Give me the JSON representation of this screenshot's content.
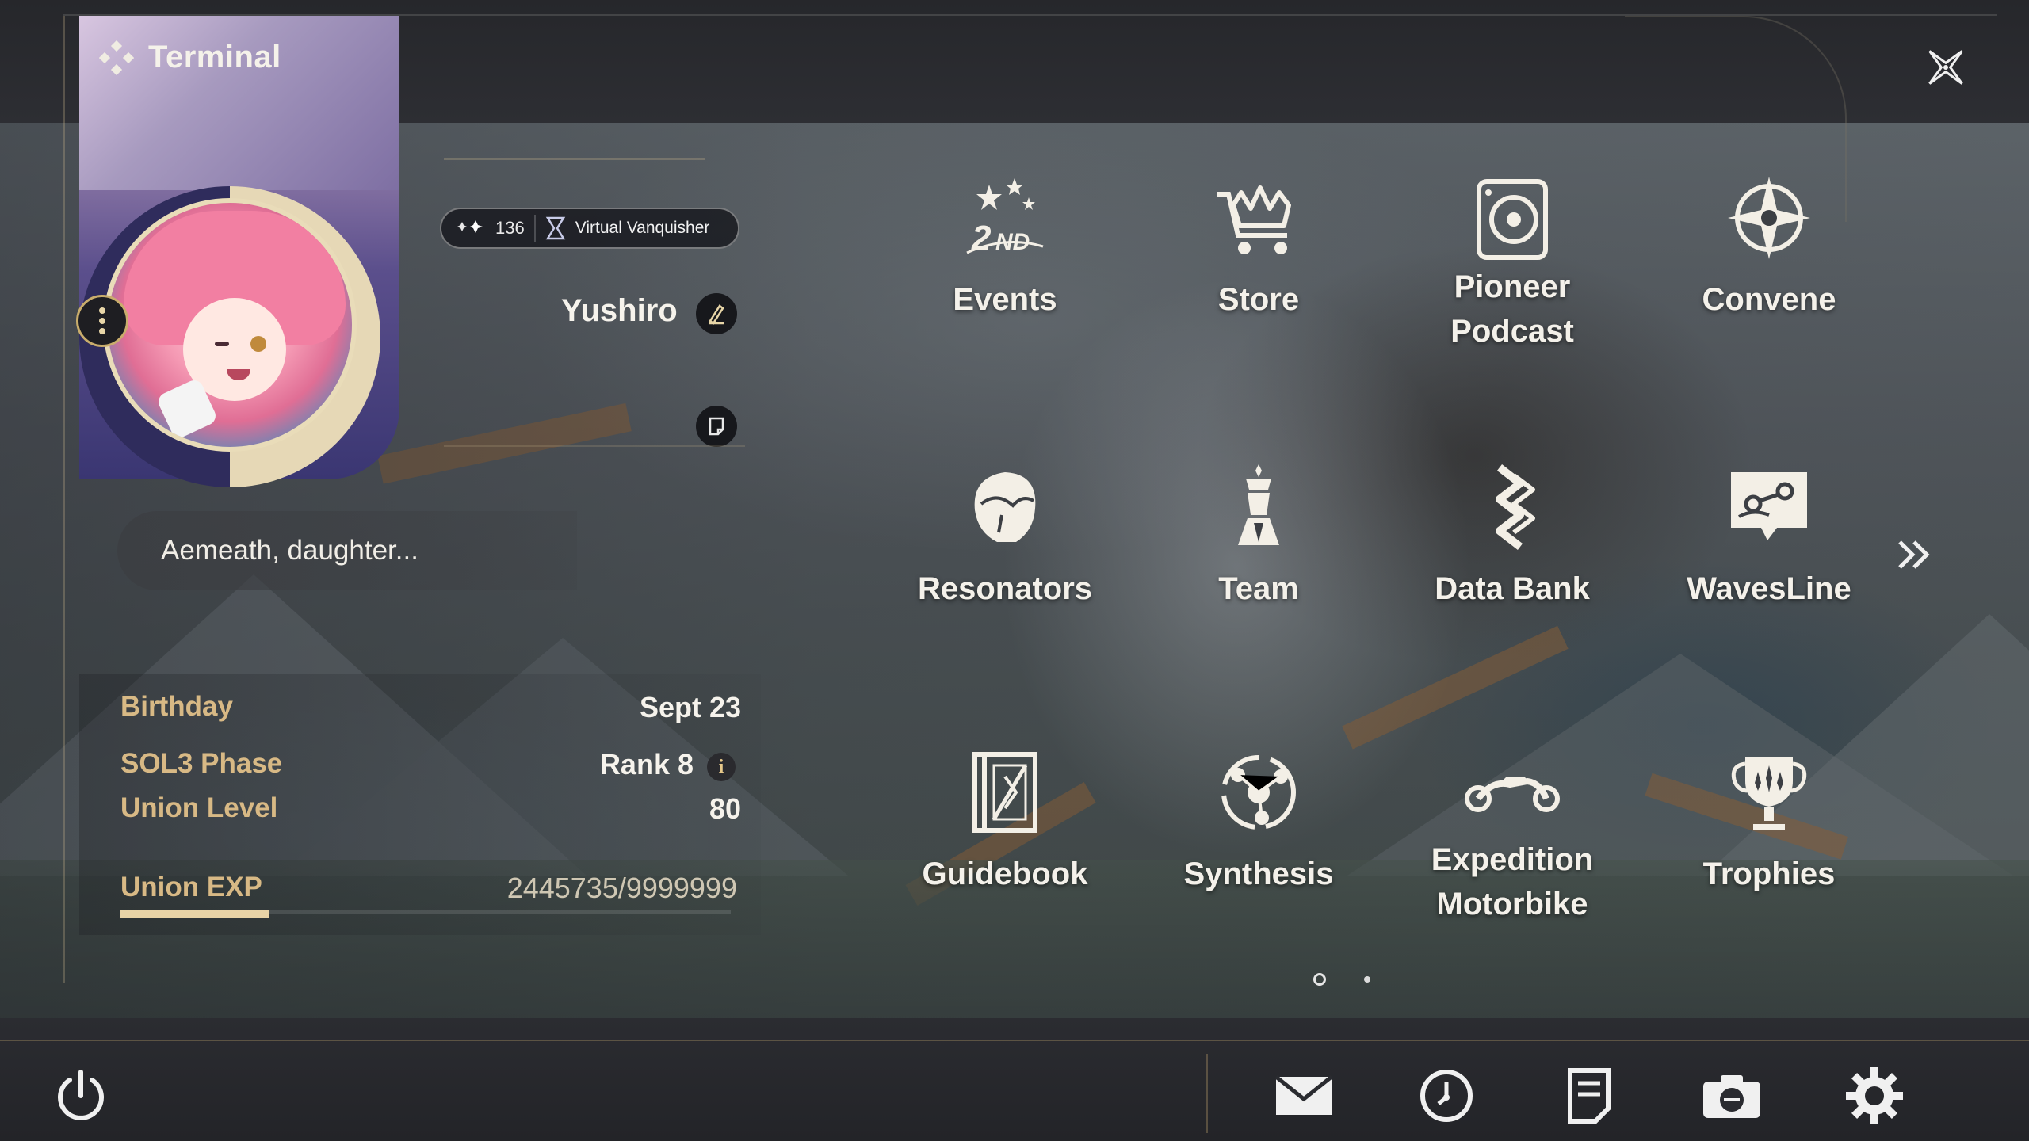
{
  "header": {
    "title": "Terminal"
  },
  "profile": {
    "badge_count": "136",
    "badge_title": "Virtual Vanquisher",
    "name": "Yushiro",
    "signature": "Aemeath, daughter...",
    "stats": {
      "birthday_label": "Birthday",
      "birthday_value": "Sept 23",
      "sol3_label": "SOL3 Phase",
      "sol3_value": "Rank 8",
      "union_level_label": "Union Level",
      "union_level_value": "80",
      "union_exp_label": "Union EXP",
      "union_exp_value": "2445735/9999999",
      "union_exp_fraction": 0.2446
    }
  },
  "menu": {
    "events": "Events",
    "store": "Store",
    "pioneer_podcast": "Pioneer\nPodcast",
    "convene": "Convene",
    "resonators": "Resonators",
    "team": "Team",
    "data_bank": "Data Bank",
    "wavesline": "WavesLine",
    "guidebook": "Guidebook",
    "synthesis": "Synthesis",
    "expedition_motorbike": "Expedition\nMotorbike",
    "trophies": "Trophies"
  },
  "pagination": {
    "current": 1,
    "total": 2
  },
  "icons": {
    "close": "close-icon",
    "terminal": "terminal-diamond-icon",
    "power": "power-icon",
    "mail": "mail-icon",
    "clock": "clock-icon",
    "notes": "notes-icon",
    "camera": "camera-icon",
    "settings": "gear-icon"
  },
  "colors": {
    "accent_gold": "#d8b985",
    "text": "#f4f1ea",
    "bar_bg": "#26272b"
  }
}
